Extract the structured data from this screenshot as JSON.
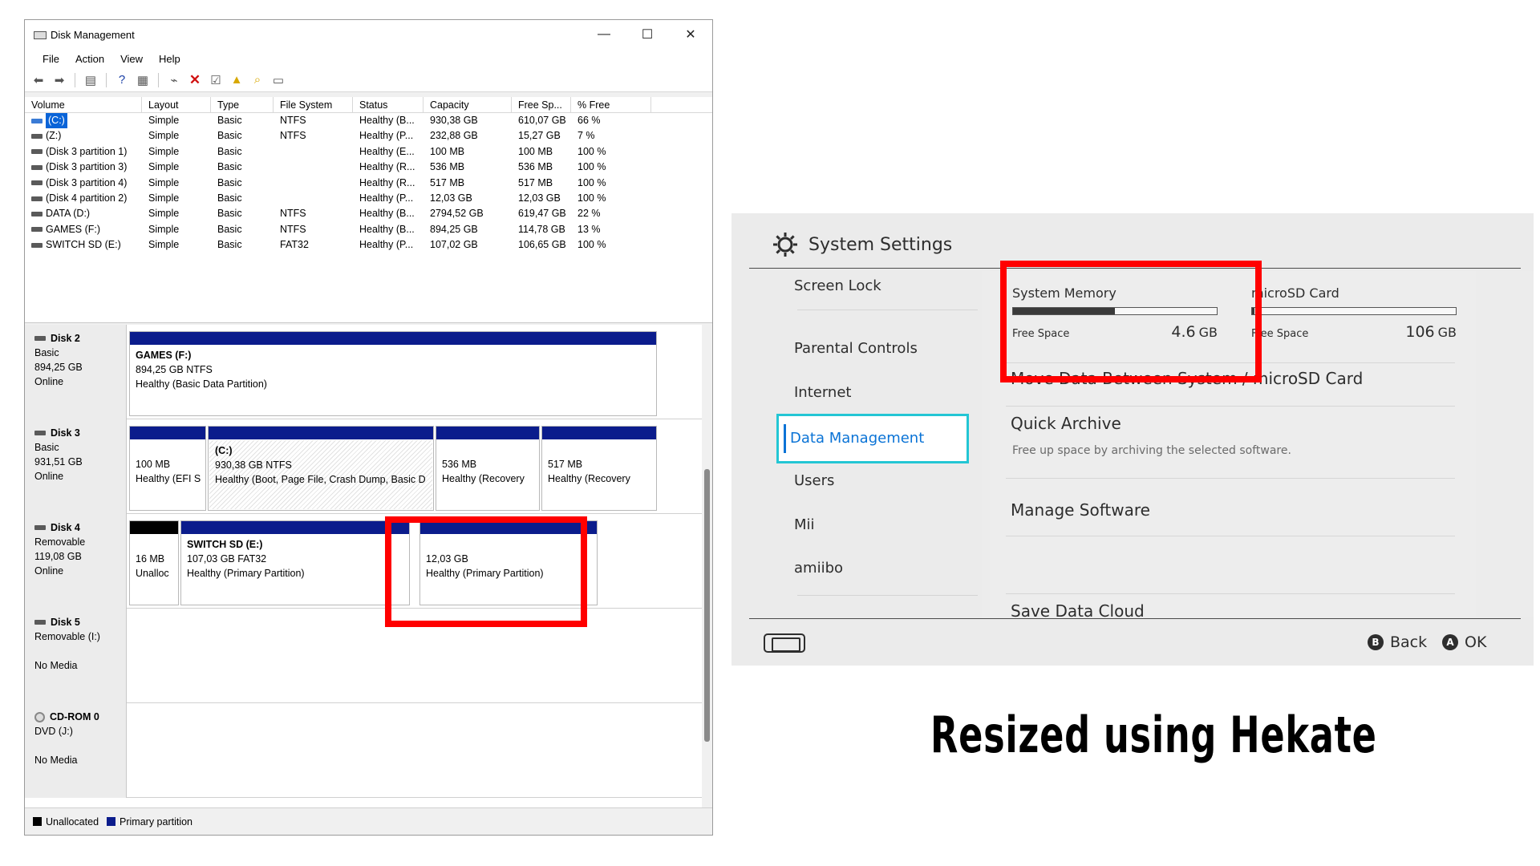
{
  "disk_management": {
    "window_title": "Disk Management",
    "menu": [
      "File",
      "Action",
      "View",
      "Help"
    ],
    "columns": [
      "Volume",
      "Layout",
      "Type",
      "File System",
      "Status",
      "Capacity",
      "Free Sp...",
      "% Free"
    ],
    "volumes": [
      {
        "volume": "(C:)",
        "layout": "Simple",
        "type": "Basic",
        "fs": "NTFS",
        "status": "Healthy (B...",
        "capacity": "930,38 GB",
        "free": "610,07 GB",
        "pct": "66 %"
      },
      {
        "volume": "(Z:)",
        "layout": "Simple",
        "type": "Basic",
        "fs": "NTFS",
        "status": "Healthy (P...",
        "capacity": "232,88 GB",
        "free": "15,27 GB",
        "pct": "7 %"
      },
      {
        "volume": "(Disk 3 partition 1)",
        "layout": "Simple",
        "type": "Basic",
        "fs": "",
        "status": "Healthy (E...",
        "capacity": "100 MB",
        "free": "100 MB",
        "pct": "100 %"
      },
      {
        "volume": "(Disk 3 partition 3)",
        "layout": "Simple",
        "type": "Basic",
        "fs": "",
        "status": "Healthy (R...",
        "capacity": "536 MB",
        "free": "536 MB",
        "pct": "100 %"
      },
      {
        "volume": "(Disk 3 partition 4)",
        "layout": "Simple",
        "type": "Basic",
        "fs": "",
        "status": "Healthy (R...",
        "capacity": "517 MB",
        "free": "517 MB",
        "pct": "100 %"
      },
      {
        "volume": "(Disk 4 partition 2)",
        "layout": "Simple",
        "type": "Basic",
        "fs": "",
        "status": "Healthy (P...",
        "capacity": "12,03 GB",
        "free": "12,03 GB",
        "pct": "100 %"
      },
      {
        "volume": "DATA (D:)",
        "layout": "Simple",
        "type": "Basic",
        "fs": "NTFS",
        "status": "Healthy (B...",
        "capacity": "2794,52 GB",
        "free": "619,47 GB",
        "pct": "22 %"
      },
      {
        "volume": "GAMES (F:)",
        "layout": "Simple",
        "type": "Basic",
        "fs": "NTFS",
        "status": "Healthy (B...",
        "capacity": "894,25 GB",
        "free": "114,78 GB",
        "pct": "13 %"
      },
      {
        "volume": "SWITCH SD (E:)",
        "layout": "Simple",
        "type": "Basic",
        "fs": "FAT32",
        "status": "Healthy (P...",
        "capacity": "107,02 GB",
        "free": "106,65 GB",
        "pct": "100 %"
      }
    ],
    "disks": {
      "disk2": {
        "name": "Disk 2",
        "type": "Basic",
        "size": "894,25 GB",
        "state": "Online",
        "p1": {
          "title": "GAMES  (F:)",
          "line1": "894,25 GB NTFS",
          "line2": "Healthy (Basic Data Partition)"
        }
      },
      "disk3": {
        "name": "Disk 3",
        "type": "Basic",
        "size": "931,51 GB",
        "state": "Online",
        "p1": {
          "line1": "100 MB",
          "line2": "Healthy (EFI S"
        },
        "p2": {
          "title": "(C:)",
          "line1": "930,38 GB NTFS",
          "line2": "Healthy (Boot, Page File, Crash Dump, Basic D"
        },
        "p3": {
          "line1": "536 MB",
          "line2": "Healthy (Recovery"
        },
        "p4": {
          "line1": "517 MB",
          "line2": "Healthy (Recovery"
        }
      },
      "disk4": {
        "name": "Disk 4",
        "type": "Removable",
        "size": "119,08 GB",
        "state": "Online",
        "p1": {
          "line1": "16 MB",
          "line2": "Unalloc"
        },
        "p2": {
          "title": "SWITCH SD  (E:)",
          "line1": "107,03 GB FAT32",
          "line2": "Healthy (Primary Partition)"
        },
        "p3": {
          "line1": "12,03 GB",
          "line2": "Healthy (Primary Partition)"
        }
      },
      "disk5": {
        "name": "Disk 5",
        "type": "Removable (I:)",
        "state": "No Media"
      },
      "cdrom0": {
        "name": "CD-ROM 0",
        "type": "DVD (J:)",
        "state": "No Media"
      }
    },
    "legend": {
      "unallocated": "Unallocated",
      "primary": "Primary partition"
    },
    "colors": {
      "primary_partition": "#0b1c8c",
      "unallocated": "#000000",
      "highlight": "#ff0000"
    }
  },
  "switch_settings": {
    "title": "System Settings",
    "nav": [
      "Screen Lock",
      "Parental Controls",
      "Internet",
      "Data Management",
      "Users",
      "Mii",
      "amiibo"
    ],
    "active_nav": "Data Management",
    "system_memory": {
      "label": "System Memory",
      "free_label": "Free Space",
      "amount": "4.6",
      "unit": "GB",
      "used_fraction": 0.5
    },
    "microsd": {
      "label": "microSD Card",
      "free_label": "Free Space",
      "amount": "106",
      "unit": "GB",
      "used_fraction": 0.01
    },
    "items": [
      "Move Data Between System / microSD Card",
      "Quick Archive",
      "Manage Software",
      "Save Data Cloud"
    ],
    "quick_archive_desc": "Free up space by archiving the selected software.",
    "footer": {
      "back_button": "B",
      "back_label": "Back",
      "ok_button": "A",
      "ok_label": "OK"
    },
    "colors": {
      "active_text": "#0a73d6",
      "active_border": "#23c6d4"
    }
  },
  "caption": "Resized using Hekate"
}
